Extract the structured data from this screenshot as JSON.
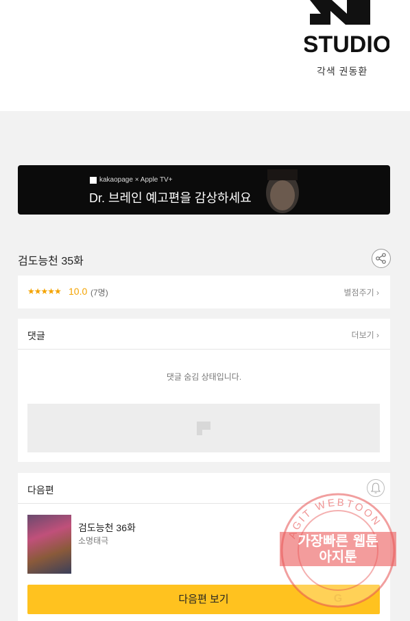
{
  "header": {
    "studio_logo_text": "STUDIO",
    "credit": "각색 권동환"
  },
  "banner": {
    "brand": "kakaopage × Apple TV+",
    "text": "Dr. 브레인 예고편을 감상하세요"
  },
  "episode": {
    "title": "검도능천 35화"
  },
  "rating": {
    "stars": "★★★★★",
    "score": "10.0",
    "count": "(7명)",
    "rate_link": "별점주기 ›"
  },
  "comments": {
    "title": "댓글",
    "more_link": "더보기 ›",
    "hidden_message": "댓글 숨김 상태입니다."
  },
  "next_episode": {
    "section_title": "다음편",
    "title": "검도능천 36화",
    "author": "소명태극",
    "button_label": "다음편 보기"
  },
  "watermark": {
    "ring_text": "AGIT WEBTOON",
    "line1": "가장빠른 웹툰",
    "line2": "아지툰"
  },
  "colors": {
    "accent_yellow": "#ffc21f",
    "star_orange": "#f4a300"
  }
}
